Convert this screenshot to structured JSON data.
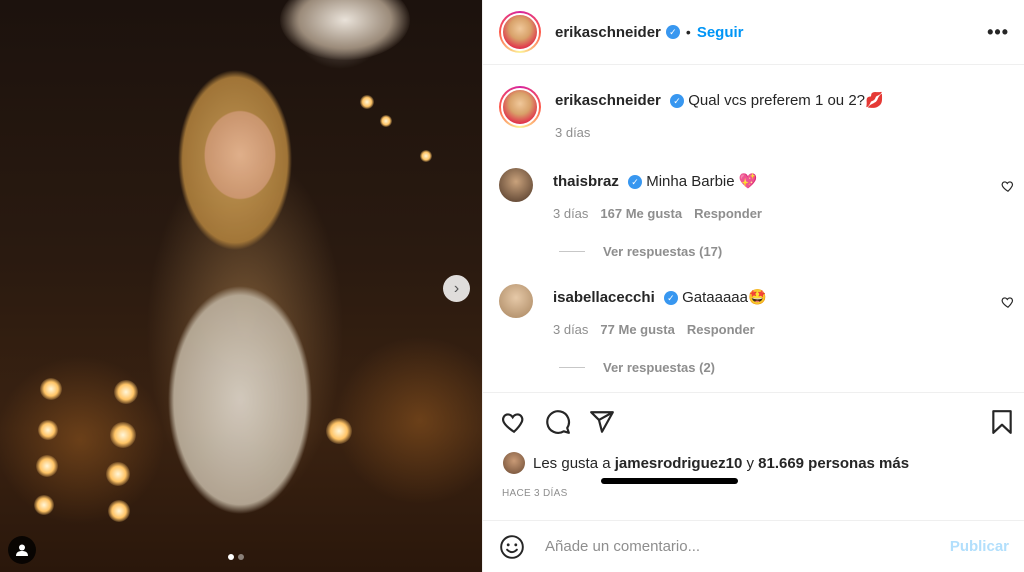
{
  "post": {
    "author": "erikaschneider",
    "follow_label": "Seguir",
    "separator": "•",
    "more_label": "•••",
    "caption": "Qual vcs preferem 1 ou 2?💋",
    "caption_time": "3 días"
  },
  "comments": [
    {
      "user": "thaisbraz",
      "text": "Minha Barbie 💖",
      "time": "3 días",
      "likes": "167 Me gusta",
      "reply_label": "Responder",
      "view_replies": "Ver respuestas (17)"
    },
    {
      "user": "isabellacecchi",
      "text": "Gataaaaa🤩",
      "time": "3 días",
      "likes": "77 Me gusta",
      "reply_label": "Responder",
      "view_replies": "Ver respuestas (2)"
    }
  ],
  "likes_line": {
    "prefix": "Les gusta a",
    "user": "jamesrodriguez10",
    "connector": "y",
    "others": "81.669 personas más"
  },
  "time_ago": "HACE 3 DÍAS",
  "add_comment": {
    "placeholder": "Añade un comentario...",
    "publish_label": "Publicar"
  },
  "carousel": {
    "slides": 2,
    "active": 1
  },
  "colors": {
    "link": "#0095f6",
    "verified": "#3897f0",
    "muted": "#8e8e8e",
    "publish_disabled": "#b2dffc"
  }
}
